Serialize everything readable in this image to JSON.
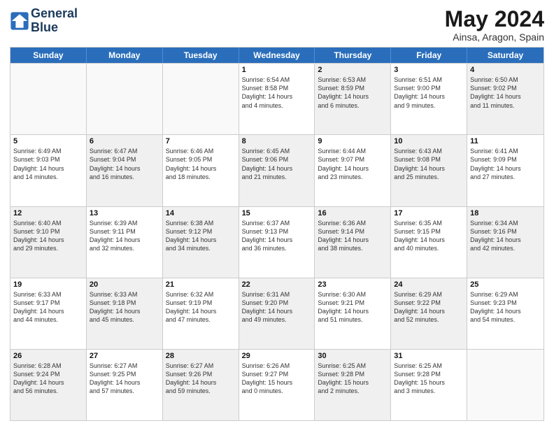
{
  "header": {
    "logo_line1": "General",
    "logo_line2": "Blue",
    "month": "May 2024",
    "location": "Ainsa, Aragon, Spain"
  },
  "weekdays": [
    "Sunday",
    "Monday",
    "Tuesday",
    "Wednesday",
    "Thursday",
    "Friday",
    "Saturday"
  ],
  "rows": [
    [
      {
        "day": "",
        "info": "",
        "shaded": false
      },
      {
        "day": "",
        "info": "",
        "shaded": false
      },
      {
        "day": "",
        "info": "",
        "shaded": false
      },
      {
        "day": "1",
        "info": "Sunrise: 6:54 AM\nSunset: 8:58 PM\nDaylight: 14 hours\nand 4 minutes.",
        "shaded": false
      },
      {
        "day": "2",
        "info": "Sunrise: 6:53 AM\nSunset: 8:59 PM\nDaylight: 14 hours\nand 6 minutes.",
        "shaded": true
      },
      {
        "day": "3",
        "info": "Sunrise: 6:51 AM\nSunset: 9:00 PM\nDaylight: 14 hours\nand 9 minutes.",
        "shaded": false
      },
      {
        "day": "4",
        "info": "Sunrise: 6:50 AM\nSunset: 9:02 PM\nDaylight: 14 hours\nand 11 minutes.",
        "shaded": true
      }
    ],
    [
      {
        "day": "5",
        "info": "Sunrise: 6:49 AM\nSunset: 9:03 PM\nDaylight: 14 hours\nand 14 minutes.",
        "shaded": false
      },
      {
        "day": "6",
        "info": "Sunrise: 6:47 AM\nSunset: 9:04 PM\nDaylight: 14 hours\nand 16 minutes.",
        "shaded": true
      },
      {
        "day": "7",
        "info": "Sunrise: 6:46 AM\nSunset: 9:05 PM\nDaylight: 14 hours\nand 18 minutes.",
        "shaded": false
      },
      {
        "day": "8",
        "info": "Sunrise: 6:45 AM\nSunset: 9:06 PM\nDaylight: 14 hours\nand 21 minutes.",
        "shaded": true
      },
      {
        "day": "9",
        "info": "Sunrise: 6:44 AM\nSunset: 9:07 PM\nDaylight: 14 hours\nand 23 minutes.",
        "shaded": false
      },
      {
        "day": "10",
        "info": "Sunrise: 6:43 AM\nSunset: 9:08 PM\nDaylight: 14 hours\nand 25 minutes.",
        "shaded": true
      },
      {
        "day": "11",
        "info": "Sunrise: 6:41 AM\nSunset: 9:09 PM\nDaylight: 14 hours\nand 27 minutes.",
        "shaded": false
      }
    ],
    [
      {
        "day": "12",
        "info": "Sunrise: 6:40 AM\nSunset: 9:10 PM\nDaylight: 14 hours\nand 29 minutes.",
        "shaded": true
      },
      {
        "day": "13",
        "info": "Sunrise: 6:39 AM\nSunset: 9:11 PM\nDaylight: 14 hours\nand 32 minutes.",
        "shaded": false
      },
      {
        "day": "14",
        "info": "Sunrise: 6:38 AM\nSunset: 9:12 PM\nDaylight: 14 hours\nand 34 minutes.",
        "shaded": true
      },
      {
        "day": "15",
        "info": "Sunrise: 6:37 AM\nSunset: 9:13 PM\nDaylight: 14 hours\nand 36 minutes.",
        "shaded": false
      },
      {
        "day": "16",
        "info": "Sunrise: 6:36 AM\nSunset: 9:14 PM\nDaylight: 14 hours\nand 38 minutes.",
        "shaded": true
      },
      {
        "day": "17",
        "info": "Sunrise: 6:35 AM\nSunset: 9:15 PM\nDaylight: 14 hours\nand 40 minutes.",
        "shaded": false
      },
      {
        "day": "18",
        "info": "Sunrise: 6:34 AM\nSunset: 9:16 PM\nDaylight: 14 hours\nand 42 minutes.",
        "shaded": true
      }
    ],
    [
      {
        "day": "19",
        "info": "Sunrise: 6:33 AM\nSunset: 9:17 PM\nDaylight: 14 hours\nand 44 minutes.",
        "shaded": false
      },
      {
        "day": "20",
        "info": "Sunrise: 6:33 AM\nSunset: 9:18 PM\nDaylight: 14 hours\nand 45 minutes.",
        "shaded": true
      },
      {
        "day": "21",
        "info": "Sunrise: 6:32 AM\nSunset: 9:19 PM\nDaylight: 14 hours\nand 47 minutes.",
        "shaded": false
      },
      {
        "day": "22",
        "info": "Sunrise: 6:31 AM\nSunset: 9:20 PM\nDaylight: 14 hours\nand 49 minutes.",
        "shaded": true
      },
      {
        "day": "23",
        "info": "Sunrise: 6:30 AM\nSunset: 9:21 PM\nDaylight: 14 hours\nand 51 minutes.",
        "shaded": false
      },
      {
        "day": "24",
        "info": "Sunrise: 6:29 AM\nSunset: 9:22 PM\nDaylight: 14 hours\nand 52 minutes.",
        "shaded": true
      },
      {
        "day": "25",
        "info": "Sunrise: 6:29 AM\nSunset: 9:23 PM\nDaylight: 14 hours\nand 54 minutes.",
        "shaded": false
      }
    ],
    [
      {
        "day": "26",
        "info": "Sunrise: 6:28 AM\nSunset: 9:24 PM\nDaylight: 14 hours\nand 56 minutes.",
        "shaded": true
      },
      {
        "day": "27",
        "info": "Sunrise: 6:27 AM\nSunset: 9:25 PM\nDaylight: 14 hours\nand 57 minutes.",
        "shaded": false
      },
      {
        "day": "28",
        "info": "Sunrise: 6:27 AM\nSunset: 9:26 PM\nDaylight: 14 hours\nand 59 minutes.",
        "shaded": true
      },
      {
        "day": "29",
        "info": "Sunrise: 6:26 AM\nSunset: 9:27 PM\nDaylight: 15 hours\nand 0 minutes.",
        "shaded": false
      },
      {
        "day": "30",
        "info": "Sunrise: 6:25 AM\nSunset: 9:28 PM\nDaylight: 15 hours\nand 2 minutes.",
        "shaded": true
      },
      {
        "day": "31",
        "info": "Sunrise: 6:25 AM\nSunset: 9:28 PM\nDaylight: 15 hours\nand 3 minutes.",
        "shaded": false
      },
      {
        "day": "",
        "info": "",
        "shaded": false
      }
    ]
  ]
}
